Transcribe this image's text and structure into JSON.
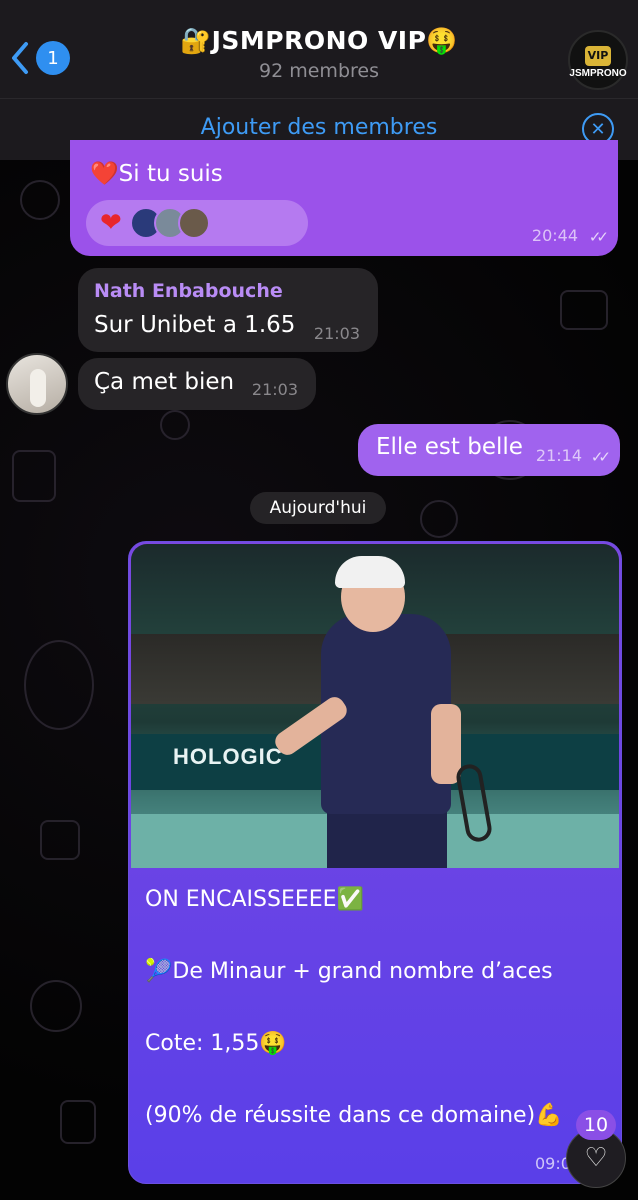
{
  "header": {
    "back_count": "1",
    "title": "🔐JSMPRONO VIP🤑",
    "subtitle": "92 membres",
    "avatar_vip": "VIP",
    "avatar_text": "JSMPRONO"
  },
  "add_bar": {
    "label": "Ajouter des membres"
  },
  "messages": [
    {
      "type": "outgoing",
      "text": "❤️Si tu suis",
      "time": "20:44",
      "reactions": {
        "emoji": "❤️",
        "avatar_count": 3
      }
    },
    {
      "type": "incoming",
      "sender": "Nath Enbabouche",
      "text": "Sur Unibet a 1.65",
      "time": "21:03"
    },
    {
      "type": "incoming",
      "text": "Ça met bien",
      "time": "21:03"
    },
    {
      "type": "outgoing",
      "text": "Elle est belle",
      "time": "21:14"
    }
  ],
  "day_separator": "Aujourd'hui",
  "post": {
    "banner_text": "HOLOGIC",
    "lines": [
      "ON ENCAISSEEEE✅",
      "🎾De Minaur + grand nombre d’aces",
      "Cote: 1,55🤑",
      "(90% de réussite dans ce domaine)💪"
    ],
    "time": "09:0"
  },
  "scroll_button": {
    "badge": "10"
  },
  "colors": {
    "outgoing": "#9a4fe6",
    "incoming": "#262427",
    "accent": "#3e9bf5"
  }
}
